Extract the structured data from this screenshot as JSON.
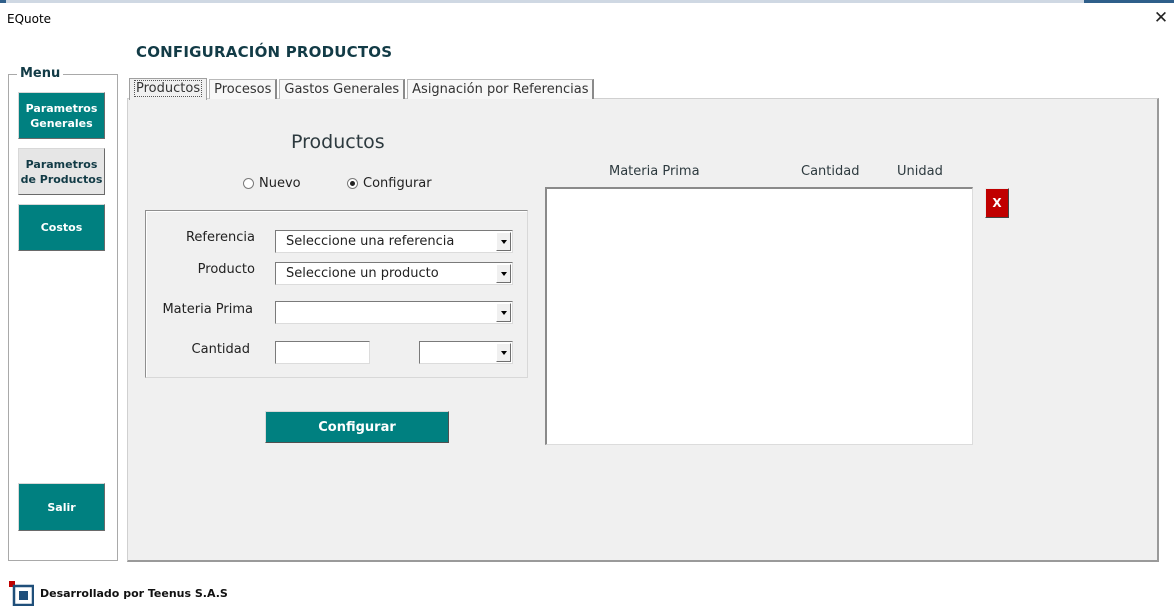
{
  "window": {
    "title": "EQuote",
    "close_glyph": "✕"
  },
  "page_title": "CONFIGURACIÓN PRODUCTOS",
  "menu": {
    "legend": "Menu",
    "items": [
      {
        "label": "Parametros Generales",
        "active": false
      },
      {
        "label": "Parametros de Productos",
        "active": true
      },
      {
        "label": "Costos",
        "active": false
      }
    ],
    "exit_label": "Salir"
  },
  "tabs": [
    {
      "label": "Productos",
      "active": true
    },
    {
      "label": "Procesos",
      "active": false
    },
    {
      "label": "Gastos Generales",
      "active": false
    },
    {
      "label": "Asignación por Referencias",
      "active": false
    }
  ],
  "section_title": "Productos",
  "mode": {
    "options": [
      {
        "label": "Nuevo",
        "checked": false
      },
      {
        "label": "Configurar",
        "checked": true
      }
    ]
  },
  "form": {
    "referencia": {
      "label": "Referencia",
      "value": "Seleccione una referencia"
    },
    "producto": {
      "label": "Producto",
      "value": "Seleccione un producto"
    },
    "materia_prima": {
      "label": "Materia Prima",
      "value": ""
    },
    "cantidad": {
      "label": "Cantidad",
      "value": "",
      "unit_value": ""
    }
  },
  "configure_button": "Configurar",
  "list": {
    "columns": [
      "Materia Prima",
      "Cantidad",
      "Unidad"
    ],
    "rows": []
  },
  "delete_button": "X",
  "footer": {
    "text": "Desarrollado por Teenus S.A.S",
    "logo_icon": "teenus-logo-icon"
  },
  "colors": {
    "teal": "#008080",
    "title": "#123b46",
    "delete": "#c00000",
    "panel": "#f0f0f0"
  }
}
